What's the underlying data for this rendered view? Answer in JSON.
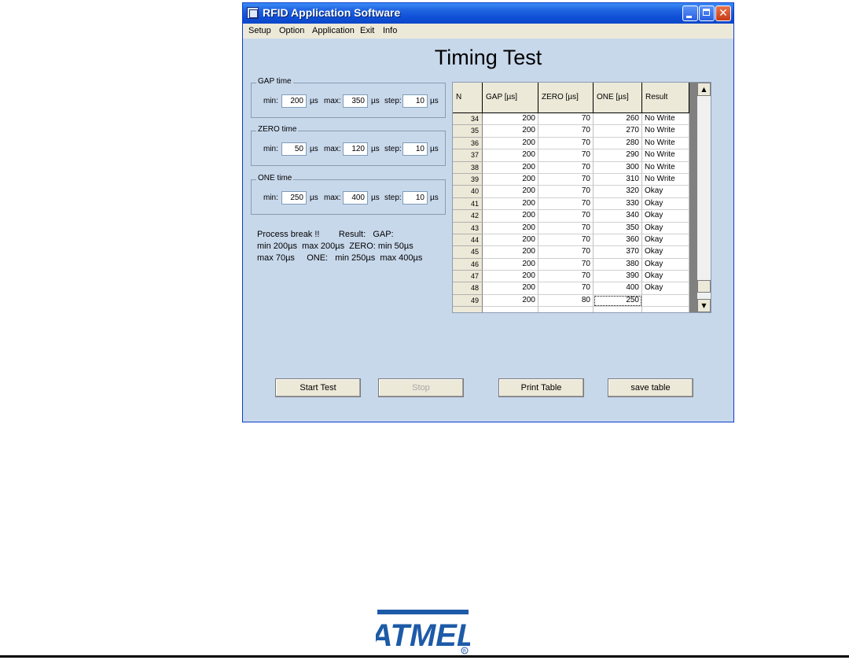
{
  "window": {
    "title": "RFID Application Software"
  },
  "menu": [
    "Setup",
    "Option",
    "Application",
    "Exit",
    "Info"
  ],
  "heading": "Timing Test",
  "groups": [
    {
      "legend": "GAP time",
      "min": "200",
      "max": "350",
      "step": "10"
    },
    {
      "legend": "ZERO time",
      "min": "50",
      "max": "120",
      "step": "10"
    },
    {
      "legend": "ONE time",
      "min": "250",
      "max": "400",
      "step": "10"
    }
  ],
  "labels": {
    "min": "min:",
    "max": "max:",
    "step": "step:",
    "unit": "µs"
  },
  "result_lines": [
    "Process break !!        Result:   GAP:",
    "min 200µs  max 200µs  ZERO: min 50µs",
    "max 70µs     ONE:   min 250µs  max 400µs"
  ],
  "table": {
    "headers": [
      "N",
      "GAP [µs]",
      "ZERO [µs]",
      "ONE [µs]",
      "Result"
    ],
    "rows": [
      [
        "34",
        "200",
        "70",
        "260",
        "No Write"
      ],
      [
        "35",
        "200",
        "70",
        "270",
        "No Write"
      ],
      [
        "36",
        "200",
        "70",
        "280",
        "No Write"
      ],
      [
        "37",
        "200",
        "70",
        "290",
        "No Write"
      ],
      [
        "38",
        "200",
        "70",
        "300",
        "No Write"
      ],
      [
        "39",
        "200",
        "70",
        "310",
        "No Write"
      ],
      [
        "40",
        "200",
        "70",
        "320",
        "Okay"
      ],
      [
        "41",
        "200",
        "70",
        "330",
        "Okay"
      ],
      [
        "42",
        "200",
        "70",
        "340",
        "Okay"
      ],
      [
        "43",
        "200",
        "70",
        "350",
        "Okay"
      ],
      [
        "44",
        "200",
        "70",
        "360",
        "Okay"
      ],
      [
        "45",
        "200",
        "70",
        "370",
        "Okay"
      ],
      [
        "46",
        "200",
        "70",
        "380",
        "Okay"
      ],
      [
        "47",
        "200",
        "70",
        "390",
        "Okay"
      ],
      [
        "48",
        "200",
        "70",
        "400",
        "Okay"
      ],
      [
        "49",
        "200",
        "80",
        "250",
        ""
      ],
      [
        "",
        "",
        "",
        "",
        ""
      ]
    ]
  },
  "buttons": {
    "start": "Start Test",
    "stop": "Stop",
    "print": "Print Table",
    "save": "save table"
  },
  "icons": {
    "minimize": "minimize-icon",
    "maximize": "maximize-icon",
    "close": "close-icon",
    "scroll_up": "arrow-up-icon",
    "scroll_down": "arrow-down-icon"
  },
  "logo_text": "ATMEL",
  "colors": {
    "titlebar": "#0f4fd6",
    "client": "#c8d8eb",
    "logo": "#1d5aa8"
  }
}
